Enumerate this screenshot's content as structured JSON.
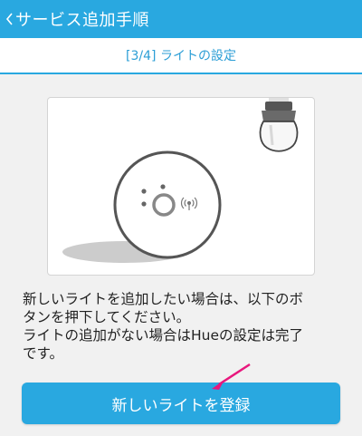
{
  "header": {
    "back_icon": "chevron-left-icon",
    "title": "サービス追加手順"
  },
  "step": {
    "title": "[3/4] ライトの設定"
  },
  "illustration": {
    "icons": [
      "hue-bridge-icon",
      "light-bulb-icon",
      "wireless-signal-icon"
    ]
  },
  "description": {
    "lines": [
      "新しいライトを追加したい場合は、以下のボ",
      "タンを押下してください。",
      "ライトの追加がない場合はHueの設定は完了",
      "です。"
    ]
  },
  "register_button": {
    "label": "新しいライトを登録"
  },
  "colors": {
    "accent": "#29a8e0",
    "pointer": "#e8177d"
  }
}
